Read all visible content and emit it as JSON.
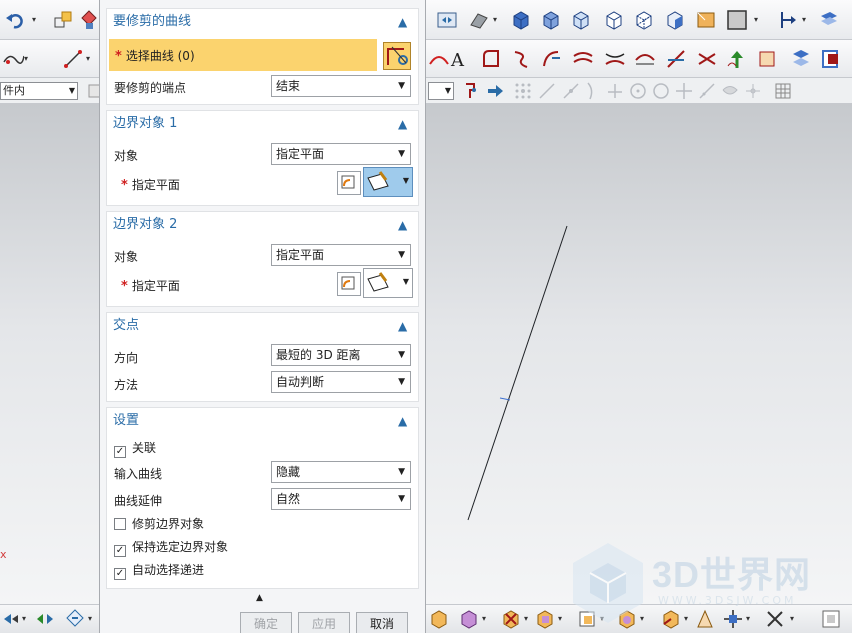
{
  "toolbar": {
    "part_filter": "件内",
    "row1_icons": [
      "undo-icon",
      "copy-icon",
      "snap-icon",
      "view-fit-icon",
      "shaded-icon",
      "solid-cube-icon",
      "shaded-cube-icon",
      "wireframe-cube-icon",
      "hidden-edge-cube-icon",
      "edge-cube-icon",
      "wcs-cube-icon",
      "background-icon",
      "render-style-icon",
      "section-view-icon",
      "plane-view-icon",
      "layer-icon"
    ],
    "row2_icons": [
      "curve-icon",
      "line-icon",
      "arc-icon",
      "text-icon",
      "fillet-icon",
      "trim-icon",
      "extend-icon",
      "offset-curve-icon",
      "divide-curve-icon",
      "bridge-icon",
      "split-curve-icon",
      "project-icon",
      "combine-icon",
      "join-curve-icon",
      "mirror-curve-icon",
      "scale-curve-icon"
    ],
    "row3_icons": [
      "select-filter-icon",
      "arrow-icon",
      "grid-snap-icon",
      "endpoint-icon",
      "midpoint-icon",
      "tangent-icon",
      "intersection-icon",
      "center-icon",
      "quadrant-icon",
      "point-on-curve-icon",
      "point-on-surface-icon",
      "existing-point-icon",
      "pole-icon"
    ]
  },
  "dialog": {
    "curve_section": {
      "title": "要修剪的曲线",
      "select_curve_label": "选择曲线 (0)",
      "endpoint_label": "要修剪的端点",
      "endpoint_value": "结束"
    },
    "boundary1": {
      "title": "边界对象 1",
      "object_label": "对象",
      "object_value": "指定平面",
      "plane_label": "指定平面"
    },
    "boundary2": {
      "title": "边界对象 2",
      "object_label": "对象",
      "object_value": "指定平面",
      "plane_label": "指定平面"
    },
    "intersection": {
      "title": "交点",
      "direction_label": "方向",
      "direction_value": "最短的 3D 距离",
      "method_label": "方法",
      "method_value": "自动判断"
    },
    "settings": {
      "title": "设置",
      "associative_label": "关联",
      "associative_checked": true,
      "input_curve_label": "输入曲线",
      "input_curve_value": "隐藏",
      "extend_label": "曲线延伸",
      "extend_value": "自然",
      "trim_boundary_label": "修剪边界对象",
      "trim_boundary_checked": false,
      "keep_selected_label": "保持选定边界对象",
      "keep_selected_checked": true,
      "auto_progress_label": "自动选择递进",
      "auto_progress_checked": true
    },
    "buttons": {
      "ok": "确定",
      "apply": "应用",
      "cancel": "取消"
    }
  },
  "viewport": {
    "axis_label": "x"
  },
  "watermark": {
    "text": "3D世界网",
    "sub": "WWW.3DSJW.COM"
  },
  "colors": {
    "accent": "#2a6ca7",
    "highlight": "#fbd36e",
    "required": "#d02020",
    "active_button": "#9fcbec"
  }
}
